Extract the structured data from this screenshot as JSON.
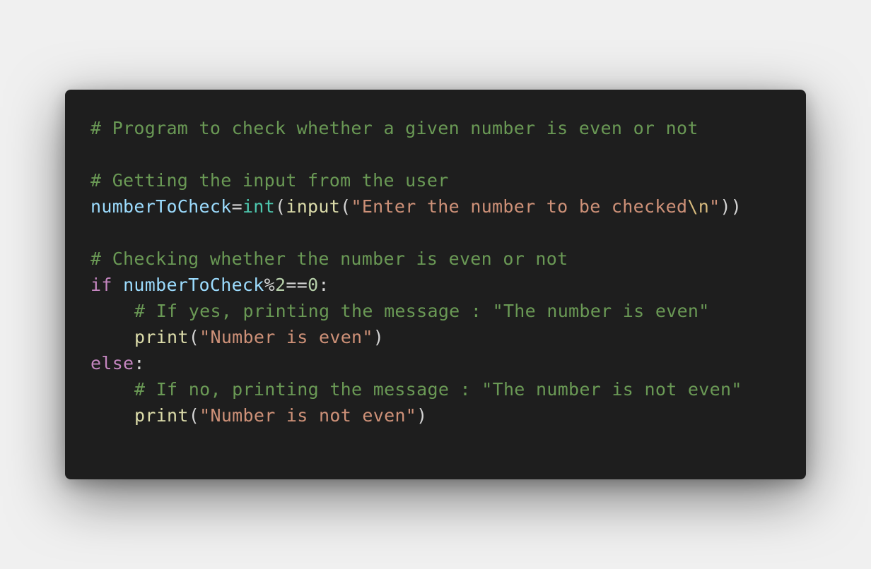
{
  "colors": {
    "page_background": "#f0f0f0",
    "editor_background": "#1e1e1e",
    "comment": "#6a9955",
    "variable": "#9cdcfe",
    "type": "#4ec9b0",
    "function": "#dcdcaa",
    "string": "#ce9178",
    "escape": "#d7ba7d",
    "keyword": "#c586c0",
    "number": "#b5cea8",
    "default": "#d4d4d4"
  },
  "code": {
    "language": "python",
    "lines": [
      {
        "tokens": [
          {
            "t": "comment",
            "v": "# Program to check whether a given number is even or not"
          }
        ]
      },
      {
        "tokens": []
      },
      {
        "tokens": [
          {
            "t": "comment",
            "v": "# Getting the input from the user"
          }
        ]
      },
      {
        "tokens": [
          {
            "t": "var",
            "v": "numberToCheck"
          },
          {
            "t": "op",
            "v": "="
          },
          {
            "t": "type",
            "v": "int"
          },
          {
            "t": "punc",
            "v": "("
          },
          {
            "t": "func",
            "v": "input"
          },
          {
            "t": "punc",
            "v": "("
          },
          {
            "t": "string",
            "v": "\"Enter the number to be checked"
          },
          {
            "t": "escape",
            "v": "\\n"
          },
          {
            "t": "string",
            "v": "\""
          },
          {
            "t": "punc",
            "v": "))"
          }
        ]
      },
      {
        "tokens": []
      },
      {
        "tokens": [
          {
            "t": "comment",
            "v": "# Checking whether the number is even or not"
          }
        ]
      },
      {
        "tokens": [
          {
            "t": "keyword",
            "v": "if"
          },
          {
            "t": "punc",
            "v": " "
          },
          {
            "t": "var",
            "v": "numberToCheck"
          },
          {
            "t": "op",
            "v": "%"
          },
          {
            "t": "number",
            "v": "2"
          },
          {
            "t": "op",
            "v": "=="
          },
          {
            "t": "number",
            "v": "0"
          },
          {
            "t": "punc",
            "v": ":"
          }
        ]
      },
      {
        "indent": 1,
        "tokens": [
          {
            "t": "comment",
            "v": "# If yes, printing the message : \"The number is even\""
          }
        ]
      },
      {
        "indent": 1,
        "tokens": [
          {
            "t": "func",
            "v": "print"
          },
          {
            "t": "punc",
            "v": "("
          },
          {
            "t": "string",
            "v": "\"Number is even\""
          },
          {
            "t": "punc",
            "v": ")"
          }
        ]
      },
      {
        "tokens": [
          {
            "t": "keyword",
            "v": "else"
          },
          {
            "t": "punc",
            "v": ":"
          }
        ]
      },
      {
        "indent": 1,
        "tokens": [
          {
            "t": "comment",
            "v": "# If no, printing the message : \"The number is not even\""
          }
        ]
      },
      {
        "indent": 1,
        "tokens": [
          {
            "t": "func",
            "v": "print"
          },
          {
            "t": "punc",
            "v": "("
          },
          {
            "t": "string",
            "v": "\"Number is not even\""
          },
          {
            "t": "punc",
            "v": ")"
          }
        ]
      }
    ]
  }
}
